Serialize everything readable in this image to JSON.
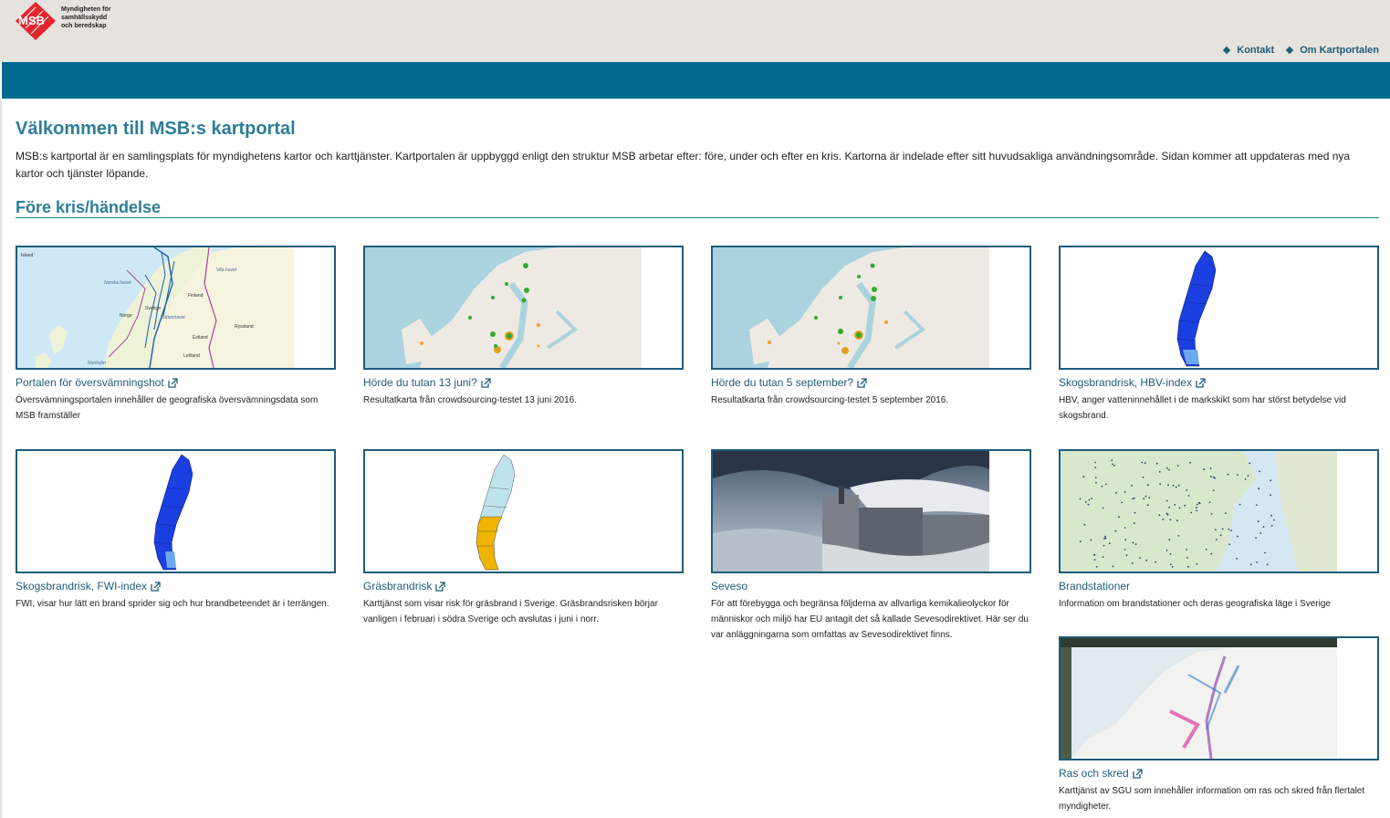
{
  "header": {
    "logo_mark": "MSB",
    "logo_lines": [
      "Myndigheten för",
      "samhällsskydd",
      "och beredskap"
    ],
    "links": [
      {
        "label": "Kontakt"
      },
      {
        "label": "Om Kartportalen"
      }
    ]
  },
  "main": {
    "title": "Välkommen till MSB:s kartportal",
    "intro": "MSB:s kartportal är en samlingsplats för myndighetens kartor och karttjänster. Kartportalen är uppbyggd enligt den struktur MSB arbetar efter: före, under och efter en kris. Kartorna är indelade efter sitt huvudsakliga användningsområde. Sidan kommer att uppdateras med nya kartor och tjänster löpande.",
    "section_title": "Före kris/händelse",
    "map_labels": [
      "Island",
      "Norska havet",
      "Vita havet",
      "Finland",
      "Sverige",
      "Norge",
      "Bottenhavet",
      "Ryssland",
      "Estland",
      "Lettland",
      "Nordsjön"
    ],
    "cards": [
      {
        "title": "Portalen för översvämningshot",
        "desc": "Översvämningsportalen innehåller de geografiska översvämningsdata som MSB framställer",
        "external": true
      },
      {
        "title": "Hörde du tutan 13 juni?",
        "desc": "Resultatkarta från crowdsourcing-testet 13 juni 2016.",
        "external": true
      },
      {
        "title": "Hörde du tutan 5 september?",
        "desc": "Resultatkarta från crowdsourcing-testet 5 september 2016.",
        "external": true
      },
      {
        "title": "Skogsbrandrisk, HBV-index",
        "desc": "HBV, anger vatteninnehållet i de markskikt som har störst betydelse vid skogsbrand.",
        "external": true
      },
      {
        "title": "Skogsbrandrisk, FWI-index",
        "desc": "FWI, visar hur lätt en brand sprider sig och hur brandbeteendet är i terrängen.",
        "external": true
      },
      {
        "title": "Gräsbrandrisk",
        "desc": "Karttjänst som visar risk för gräsbrand i Sverige. Gräsbrandsrisken börjar vanligen i februari i södra Sverige och avslutas i juni i norr.",
        "external": true
      },
      {
        "title": "Seveso",
        "desc": "För att förebygga och begränsa följderna av allvarliga kemikalieolyckor för människor och miljö har EU antagit det så kallade Sevesodirektivet. Här ser du var anläggningarna som omfattas av Sevesodirektivet finns.",
        "external": false
      },
      {
        "title": "Brandstationer",
        "desc": "Information om brandstationer och deras geografiska läge i Sverige",
        "external": false
      },
      {
        "title": "Ras och skred",
        "desc": "Karttjänst av SGU som innehåller information om ras och skred från flertalet myndigheter.",
        "external": true
      }
    ]
  },
  "colors": {
    "header_bg": "#e6e2dd",
    "navbar": "#006a8e",
    "heading": "#2d7d9a",
    "link": "#1f5c7a",
    "logo_red": "#e3262d"
  }
}
